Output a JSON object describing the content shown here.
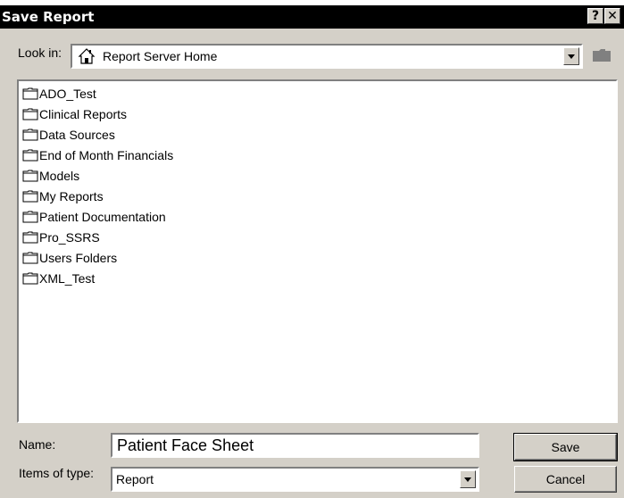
{
  "dialog": {
    "title": "Save Report",
    "help_label": "?",
    "close_label": "✕"
  },
  "lookin": {
    "label": "Look in:",
    "value": "Report Server Home"
  },
  "files": [
    {
      "name": "ADO_Test"
    },
    {
      "name": "Clinical Reports"
    },
    {
      "name": "Data Sources"
    },
    {
      "name": "End of Month Financials"
    },
    {
      "name": "Models"
    },
    {
      "name": "My Reports"
    },
    {
      "name": "Patient Documentation"
    },
    {
      "name": "Pro_SSRS"
    },
    {
      "name": "Users Folders"
    },
    {
      "name": "XML_Test"
    }
  ],
  "name_field": {
    "label": "Name:",
    "value": "Patient Face Sheet"
  },
  "type_field": {
    "label": "Items of type:",
    "value": "Report"
  },
  "buttons": {
    "save": "Save",
    "cancel": "Cancel"
  }
}
